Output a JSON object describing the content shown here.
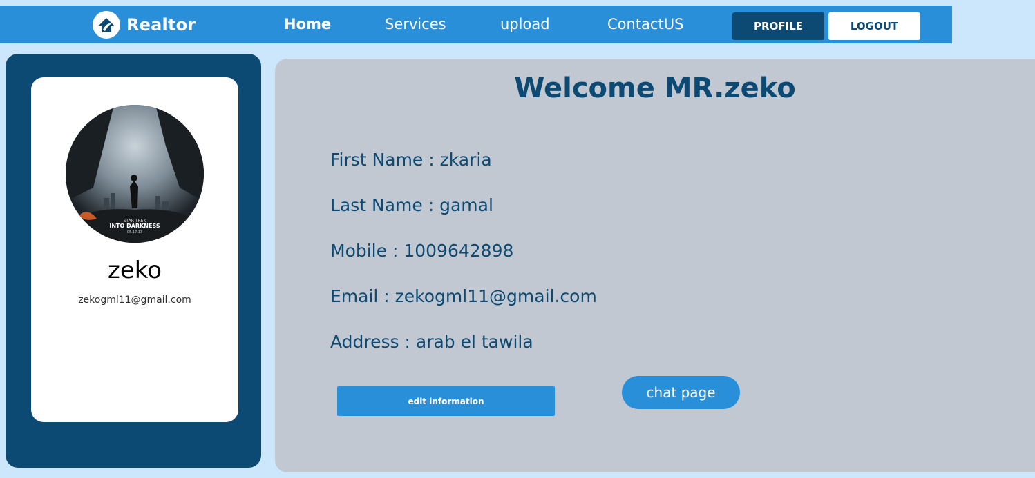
{
  "navbar": {
    "brand": "Realtor",
    "brand_icon": "house-logo-icon",
    "links": [
      "Home",
      "Services",
      "upload",
      "ContactUS"
    ],
    "profile_button": "PROFILE",
    "logout_button": "LOGOUT"
  },
  "profile_card": {
    "avatar_icon": "movie-poster-avatar",
    "avatar_text_line1": "STAR TREK",
    "avatar_text_line2": "INTO DARKNESS",
    "avatar_text_line3": "05.17.13",
    "name": "zeko",
    "email": "zekogml11@gmail.com"
  },
  "main": {
    "welcome": "Welcome MR.zeko",
    "first_name": "First Name : zkaria",
    "last_name": "Last Name : gamal",
    "mobile": "Mobile : 1009642898",
    "email": "Email : zekogml11@gmail.com",
    "address": "Address : arab el tawila",
    "edit_button": "edit information",
    "chat_button": "chat page"
  },
  "colors": {
    "background": "#cce7fb",
    "navbar": "#2a8fd9",
    "dark_blue": "#0d4a73",
    "panel_gray": "#c2c8d1",
    "white": "#ffffff"
  }
}
